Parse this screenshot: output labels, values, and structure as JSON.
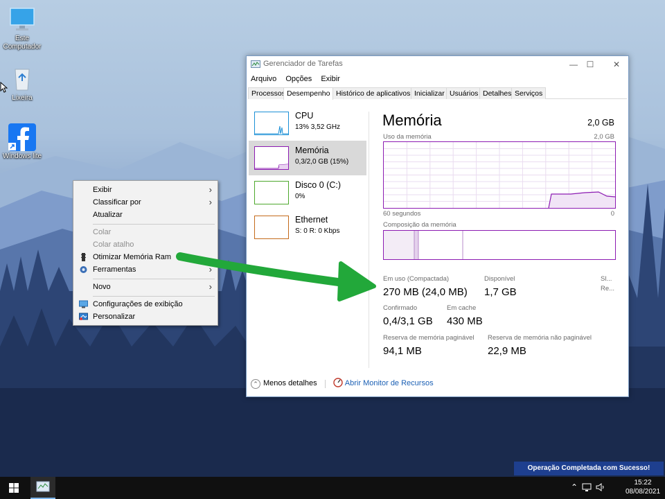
{
  "desktop": {
    "icons": [
      {
        "label": "Este Computador",
        "icon": "monitor-icon"
      },
      {
        "label": "Lixeira",
        "icon": "recycle-bin-icon"
      },
      {
        "label": "Windows lite",
        "icon": "facebook-icon"
      }
    ]
  },
  "context_menu": {
    "items": [
      {
        "label": "Exibir",
        "has_submenu": true,
        "disabled": false
      },
      {
        "label": "Classificar por",
        "has_submenu": true,
        "disabled": false
      },
      {
        "label": "Atualizar",
        "has_submenu": false,
        "disabled": false
      },
      {
        "label": "Colar",
        "has_submenu": false,
        "disabled": true
      },
      {
        "label": "Colar atalho",
        "has_submenu": false,
        "disabled": true
      },
      {
        "label": "Otimizar Memória Ram",
        "has_submenu": false,
        "disabled": false,
        "icon": "ram-icon"
      },
      {
        "label": "Ferramentas",
        "has_submenu": true,
        "disabled": false,
        "icon": "gear-icon"
      },
      {
        "label": "Novo",
        "has_submenu": true,
        "disabled": false
      },
      {
        "label": "Configurações de exibição",
        "has_submenu": false,
        "disabled": false,
        "icon": "display-icon"
      },
      {
        "label": "Personalizar",
        "has_submenu": false,
        "disabled": false,
        "icon": "personalize-icon"
      }
    ]
  },
  "task_manager": {
    "title": "Gerenciador de Tarefas",
    "menu": [
      "Arquivo",
      "Opções",
      "Exibir"
    ],
    "tabs": [
      "Processos",
      "Desempenho",
      "Histórico de aplicativos",
      "Inicializar",
      "Usuários",
      "Detalhes",
      "Serviços"
    ],
    "active_tab": "Desempenho",
    "resources": [
      {
        "name": "CPU",
        "sub": "13%  3,52 GHz",
        "color": "#1a8fd6"
      },
      {
        "name": "Memória",
        "sub": "0,3/2,0 GB (15%)",
        "color": "#8c1bb2"
      },
      {
        "name": "Disco 0 (C:)",
        "sub": "0%",
        "color": "#4da82c"
      },
      {
        "name": "Ethernet",
        "sub": "S: 0 R: 0 Kbps",
        "color": "#c46a1a"
      }
    ],
    "memory": {
      "title": "Memória",
      "total": "2,0 GB",
      "usage_label": "Uso da memória",
      "usage_max": "2,0 GB",
      "time_label": "60 segundos",
      "time_min": "0",
      "composition_label": "Composição da memória",
      "in_use_label": "Em uso (Compactada)",
      "in_use_value": "270 MB (24,0 MB)",
      "available_label": "Disponível",
      "available_value": "1,7 GB",
      "slots_label": "Sl...",
      "reserved_label": "Re...",
      "committed_label": "Confirmado",
      "committed_value": "0,4/3,1 GB",
      "cached_label": "Em cache",
      "cached_value": "430 MB",
      "paged_label": "Reserva de memória paginável",
      "paged_value": "94,1 MB",
      "nonpaged_label": "Reserva de memória não paginável",
      "nonpaged_value": "22,9 MB"
    },
    "footer": {
      "less_details": "Menos detalhes",
      "resource_monitor": "Abrir Monitor de Recursos"
    }
  },
  "toast": "Operação Completada com Sucesso!",
  "taskbar": {
    "time": "15:22",
    "date": "08/08/2021"
  },
  "colors": {
    "memory_accent": "#8c1bb2",
    "toast_bg": "#1e3f8f",
    "arrow": "#22a83a"
  }
}
